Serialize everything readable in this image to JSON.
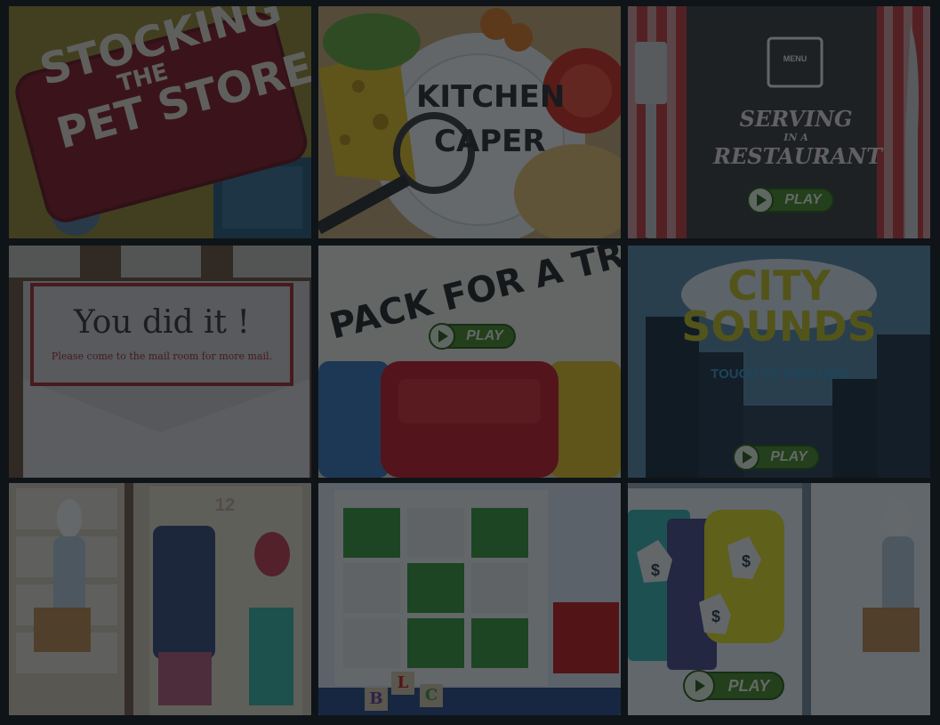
{
  "tiles": [
    {
      "id": "pet-store",
      "title_lines": [
        "STOCKING",
        "THE",
        "PET STORE"
      ]
    },
    {
      "id": "kitchen-caper",
      "title_lines": [
        "KITCHEN",
        "CAPER"
      ]
    },
    {
      "id": "restaurant",
      "menu_label": "MENU",
      "title_lines": [
        "SERVING",
        "IN A",
        "RESTAURANT"
      ],
      "play_label": "PLAY"
    },
    {
      "id": "mail",
      "heading": "You did it !",
      "message": "Please come to the mail room for more mail."
    },
    {
      "id": "pack-trip",
      "title": "PACK FOR A TRIP",
      "play_label": "PLAY"
    },
    {
      "id": "city-sounds",
      "title_lines": [
        "CITY",
        "SOUNDS"
      ],
      "subtitle": "TOUCH TO EXPLORE",
      "play_label": "PLAY"
    },
    {
      "id": "dress-up",
      "sign": "12"
    },
    {
      "id": "toy-shelf",
      "blocks": [
        "B",
        "L",
        "C"
      ]
    },
    {
      "id": "clothing-store",
      "price_tags": [
        "$",
        "$",
        "$"
      ],
      "play_label": "PLAY"
    }
  ],
  "colors": {
    "background": "#0f1418",
    "overlay": "rgba(12,17,22,0.62)",
    "play_green": "#4a8a24"
  }
}
